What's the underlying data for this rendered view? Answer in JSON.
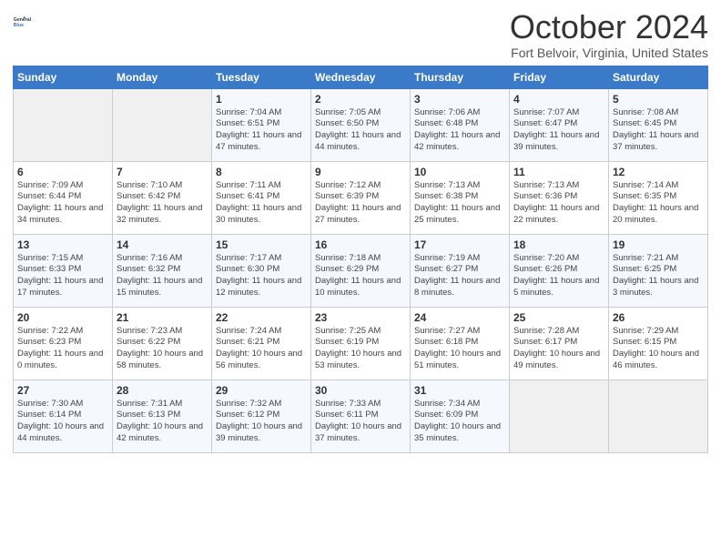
{
  "header": {
    "logo_line1": "General",
    "logo_line2": "Blue",
    "month": "October 2024",
    "location": "Fort Belvoir, Virginia, United States"
  },
  "days_of_week": [
    "Sunday",
    "Monday",
    "Tuesday",
    "Wednesday",
    "Thursday",
    "Friday",
    "Saturday"
  ],
  "weeks": [
    [
      {
        "num": "",
        "info": ""
      },
      {
        "num": "",
        "info": ""
      },
      {
        "num": "1",
        "info": "Sunrise: 7:04 AM\nSunset: 6:51 PM\nDaylight: 11 hours and 47 minutes."
      },
      {
        "num": "2",
        "info": "Sunrise: 7:05 AM\nSunset: 6:50 PM\nDaylight: 11 hours and 44 minutes."
      },
      {
        "num": "3",
        "info": "Sunrise: 7:06 AM\nSunset: 6:48 PM\nDaylight: 11 hours and 42 minutes."
      },
      {
        "num": "4",
        "info": "Sunrise: 7:07 AM\nSunset: 6:47 PM\nDaylight: 11 hours and 39 minutes."
      },
      {
        "num": "5",
        "info": "Sunrise: 7:08 AM\nSunset: 6:45 PM\nDaylight: 11 hours and 37 minutes."
      }
    ],
    [
      {
        "num": "6",
        "info": "Sunrise: 7:09 AM\nSunset: 6:44 PM\nDaylight: 11 hours and 34 minutes."
      },
      {
        "num": "7",
        "info": "Sunrise: 7:10 AM\nSunset: 6:42 PM\nDaylight: 11 hours and 32 minutes."
      },
      {
        "num": "8",
        "info": "Sunrise: 7:11 AM\nSunset: 6:41 PM\nDaylight: 11 hours and 30 minutes."
      },
      {
        "num": "9",
        "info": "Sunrise: 7:12 AM\nSunset: 6:39 PM\nDaylight: 11 hours and 27 minutes."
      },
      {
        "num": "10",
        "info": "Sunrise: 7:13 AM\nSunset: 6:38 PM\nDaylight: 11 hours and 25 minutes."
      },
      {
        "num": "11",
        "info": "Sunrise: 7:13 AM\nSunset: 6:36 PM\nDaylight: 11 hours and 22 minutes."
      },
      {
        "num": "12",
        "info": "Sunrise: 7:14 AM\nSunset: 6:35 PM\nDaylight: 11 hours and 20 minutes."
      }
    ],
    [
      {
        "num": "13",
        "info": "Sunrise: 7:15 AM\nSunset: 6:33 PM\nDaylight: 11 hours and 17 minutes."
      },
      {
        "num": "14",
        "info": "Sunrise: 7:16 AM\nSunset: 6:32 PM\nDaylight: 11 hours and 15 minutes."
      },
      {
        "num": "15",
        "info": "Sunrise: 7:17 AM\nSunset: 6:30 PM\nDaylight: 11 hours and 12 minutes."
      },
      {
        "num": "16",
        "info": "Sunrise: 7:18 AM\nSunset: 6:29 PM\nDaylight: 11 hours and 10 minutes."
      },
      {
        "num": "17",
        "info": "Sunrise: 7:19 AM\nSunset: 6:27 PM\nDaylight: 11 hours and 8 minutes."
      },
      {
        "num": "18",
        "info": "Sunrise: 7:20 AM\nSunset: 6:26 PM\nDaylight: 11 hours and 5 minutes."
      },
      {
        "num": "19",
        "info": "Sunrise: 7:21 AM\nSunset: 6:25 PM\nDaylight: 11 hours and 3 minutes."
      }
    ],
    [
      {
        "num": "20",
        "info": "Sunrise: 7:22 AM\nSunset: 6:23 PM\nDaylight: 11 hours and 0 minutes."
      },
      {
        "num": "21",
        "info": "Sunrise: 7:23 AM\nSunset: 6:22 PM\nDaylight: 10 hours and 58 minutes."
      },
      {
        "num": "22",
        "info": "Sunrise: 7:24 AM\nSunset: 6:21 PM\nDaylight: 10 hours and 56 minutes."
      },
      {
        "num": "23",
        "info": "Sunrise: 7:25 AM\nSunset: 6:19 PM\nDaylight: 10 hours and 53 minutes."
      },
      {
        "num": "24",
        "info": "Sunrise: 7:27 AM\nSunset: 6:18 PM\nDaylight: 10 hours and 51 minutes."
      },
      {
        "num": "25",
        "info": "Sunrise: 7:28 AM\nSunset: 6:17 PM\nDaylight: 10 hours and 49 minutes."
      },
      {
        "num": "26",
        "info": "Sunrise: 7:29 AM\nSunset: 6:15 PM\nDaylight: 10 hours and 46 minutes."
      }
    ],
    [
      {
        "num": "27",
        "info": "Sunrise: 7:30 AM\nSunset: 6:14 PM\nDaylight: 10 hours and 44 minutes."
      },
      {
        "num": "28",
        "info": "Sunrise: 7:31 AM\nSunset: 6:13 PM\nDaylight: 10 hours and 42 minutes."
      },
      {
        "num": "29",
        "info": "Sunrise: 7:32 AM\nSunset: 6:12 PM\nDaylight: 10 hours and 39 minutes."
      },
      {
        "num": "30",
        "info": "Sunrise: 7:33 AM\nSunset: 6:11 PM\nDaylight: 10 hours and 37 minutes."
      },
      {
        "num": "31",
        "info": "Sunrise: 7:34 AM\nSunset: 6:09 PM\nDaylight: 10 hours and 35 minutes."
      },
      {
        "num": "",
        "info": ""
      },
      {
        "num": "",
        "info": ""
      }
    ]
  ]
}
